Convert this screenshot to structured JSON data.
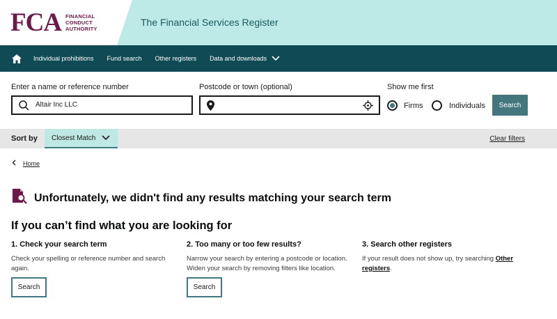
{
  "header": {
    "logo_mark": "FCA",
    "logo_line1": "FINANCIAL",
    "logo_line2": "CONDUCT",
    "logo_line3": "AUTHORITY",
    "title": "The Financial Services Register"
  },
  "nav": {
    "items": [
      {
        "label": "Individual prohibitions"
      },
      {
        "label": "Fund search"
      },
      {
        "label": "Other registers"
      },
      {
        "label": "Data and downloads"
      }
    ]
  },
  "search": {
    "name_label": "Enter a name or reference number",
    "name_value": "Altair Inc LLC",
    "postcode_label": "Postcode or town (optional)",
    "postcode_value": "",
    "show_first_label": "Show me first",
    "option_firms": "Firms",
    "option_individuals": "Individuals",
    "selected_option": "Firms",
    "search_button": "Search"
  },
  "sort": {
    "label": "Sort by",
    "selected": "Closest Match",
    "clear_filters": "Clear filters"
  },
  "breadcrumb": {
    "home": "Home"
  },
  "results": {
    "no_results_message": "Unfortunately, we didn't find any results matching your search term"
  },
  "help": {
    "title": "If you can’t find what you are looking for",
    "columns": [
      {
        "heading": "1. Check your search term",
        "text": "Check your spelling or reference number and search again.",
        "button": "Search"
      },
      {
        "heading": "2. Too many or too few results?",
        "text": "Narrow your search by entering a postcode or location. Widen your search by removing filters like location.",
        "button": "Search"
      },
      {
        "heading": "3. Search other registers",
        "text_before": "If your result does not show up, try searching ",
        "link": "Other registers",
        "text_after": "."
      }
    ]
  },
  "colors": {
    "brand": "#6b1a4a",
    "nav_bg": "#104a55",
    "header_band": "#bdeae6",
    "accent": "#44777d"
  }
}
